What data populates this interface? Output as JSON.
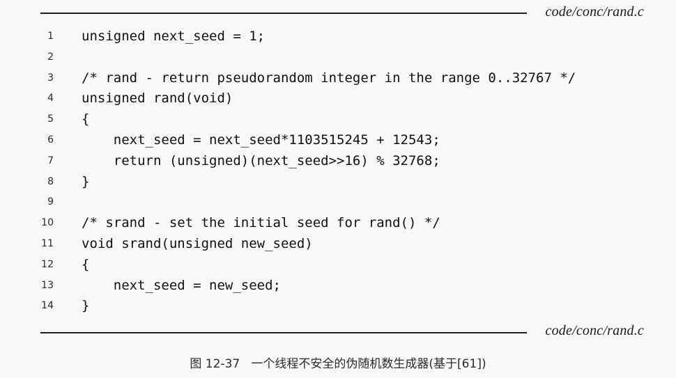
{
  "header": {
    "file_label": "code/conc/rand.c"
  },
  "code_lines": [
    {
      "num": "1",
      "code": "unsigned next_seed = 1;"
    },
    {
      "num": "2",
      "code": ""
    },
    {
      "num": "3",
      "code": "/* rand - return pseudorandom integer in the range 0..32767 */"
    },
    {
      "num": "4",
      "code": "unsigned rand(void)"
    },
    {
      "num": "5",
      "code": "{"
    },
    {
      "num": "6",
      "code": "    next_seed = next_seed*1103515245 + 12543;"
    },
    {
      "num": "7",
      "code": "    return (unsigned)(next_seed>>16) % 32768;"
    },
    {
      "num": "8",
      "code": "}"
    },
    {
      "num": "9",
      "code": ""
    },
    {
      "num": "10",
      "code": "/* srand - set the initial seed for rand() */"
    },
    {
      "num": "11",
      "code": "void srand(unsigned new_seed)"
    },
    {
      "num": "12",
      "code": "{"
    },
    {
      "num": "13",
      "code": "    next_seed = new_seed;"
    },
    {
      "num": "14",
      "code": "}"
    }
  ],
  "footer": {
    "file_label": "code/conc/rand.c"
  },
  "caption": {
    "text": "图 12-37   一个线程不安全的伪随机数生成器(基于[61])"
  }
}
